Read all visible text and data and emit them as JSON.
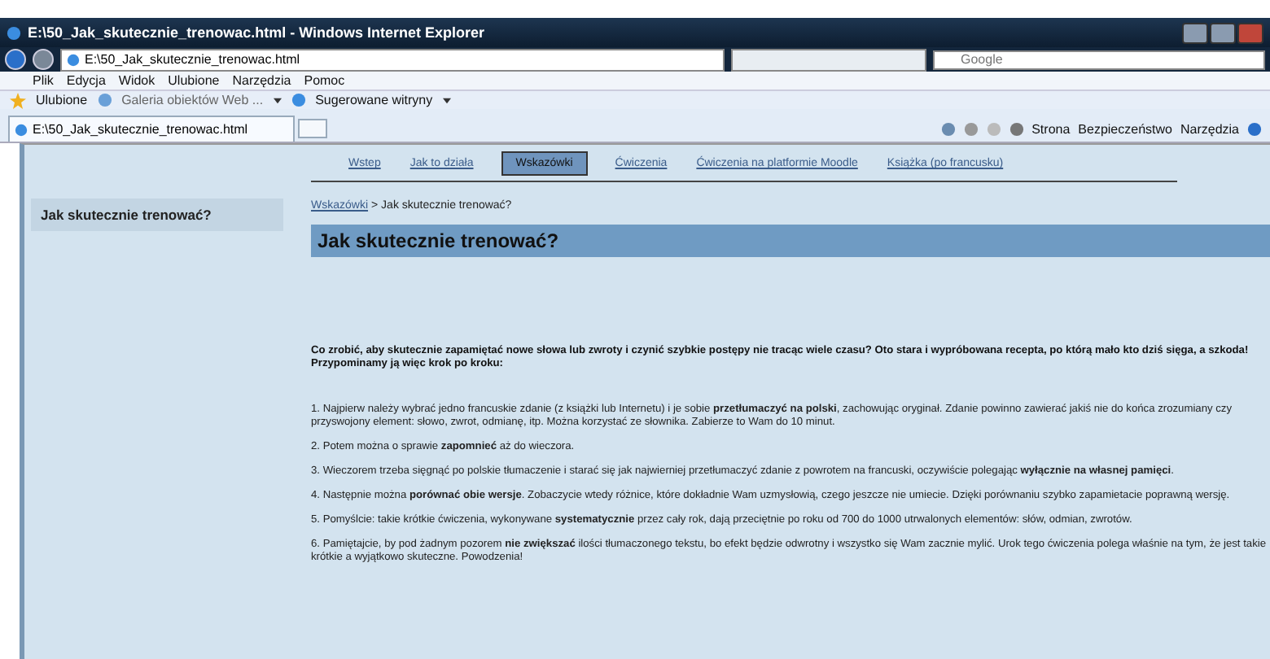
{
  "window": {
    "title": "E:\\50_Jak_skutecznie_trenowac.html - Windows Internet Explorer"
  },
  "address_bar": {
    "value": "E:\\50_Jak_skutecznie_trenowac.html"
  },
  "search": {
    "placeholder": "Google"
  },
  "menu": [
    "Plik",
    "Edycja",
    "Widok",
    "Ulubione",
    "Narzędzia",
    "Pomoc"
  ],
  "favorites_bar": {
    "favorites": "Ulubione",
    "items": [
      {
        "label": "Galeria obiektów Web ...",
        "kind": "gallery"
      },
      {
        "label": "Sugerowane witryny",
        "kind": "suggested"
      }
    ]
  },
  "browser_tabs": [
    {
      "label": "E:\\50_Jak_skutecznie_trenowac.html",
      "selected": true
    }
  ],
  "command_bar": [
    "Strona",
    "Bezpieczeństwo",
    "Narzędzia"
  ],
  "nav": [
    {
      "label": "Wstep",
      "selected": false
    },
    {
      "label": "Jak to działa",
      "selected": false
    },
    {
      "label": "Wskazówki",
      "selected": true
    },
    {
      "label": "Ćwiczenia",
      "selected": false
    },
    {
      "label": "Ćwiczenia na platformie Moodle",
      "selected": false
    },
    {
      "label": "Książka (po francusku)",
      "selected": false
    }
  ],
  "sidebar": {
    "items": [
      "Jak skutecznie trenować?"
    ]
  },
  "breadcrumb": {
    "link": "Wskazówki",
    "current": "> Jak skutecznie trenować?"
  },
  "heading": "Jak skutecznie trenować?",
  "intro": "Co zrobić, aby skutecznie zapamiętać nowe słowa lub zwroty i czynić szybkie postępy nie tracąc wiele czasu? Oto stara  i wypróbowana recepta, po którą mało kto dziś sięga, a szkoda! Przypominamy ją więc krok po kroku:",
  "steps": [
    "1. Najpierw należy wybrać jedno francuskie zdanie (z książki lub Internetu) i je sobie **przetłumaczyć na polski**, zachowując oryginał. Zdanie powinno zawierać jakiś nie do końca zrozumiany czy przyswojony element: słowo, zwrot, odmianę, itp. Można korzystać ze słownika. Zabierze to Wam do 10 minut.",
    "2. Potem można o sprawie **zapomnieć** aż do wieczora.",
    "3. Wieczorem trzeba sięgnąć po polskie tłumaczenie i starać się jak najwierniej przetłumaczyć zdanie z powrotem na francuski, oczywiście polegając **wyłącznie na własnej pamięci**.",
    "4. Następnie można **porównać obie wersje**. Zobaczycie wtedy różnice, które dokładnie Wam uzmysłowią, czego jeszcze nie umiecie.  Dzięki porównaniu szybko zapamietacie poprawną wersję.",
    "5. Pomyślcie: takie krótkie ćwiczenia, wykonywane **systematycznie** przez cały rok, dają przeciętnie po roku od 700 do 1000 utrwalonych elementów: słów, odmian, zwrotów.",
    "6. Pamiętajcie, by pod żadnym pozorem **nie zwiększać** ilości tłumaczonego tekstu, bo efekt będzie odwrotny i wszystko się Wam zacznie mylić. Urok tego ćwiczenia polega właśnie na tym, że jest takie krótkie a wyjątkowo skuteczne. Powodzenia!"
  ]
}
